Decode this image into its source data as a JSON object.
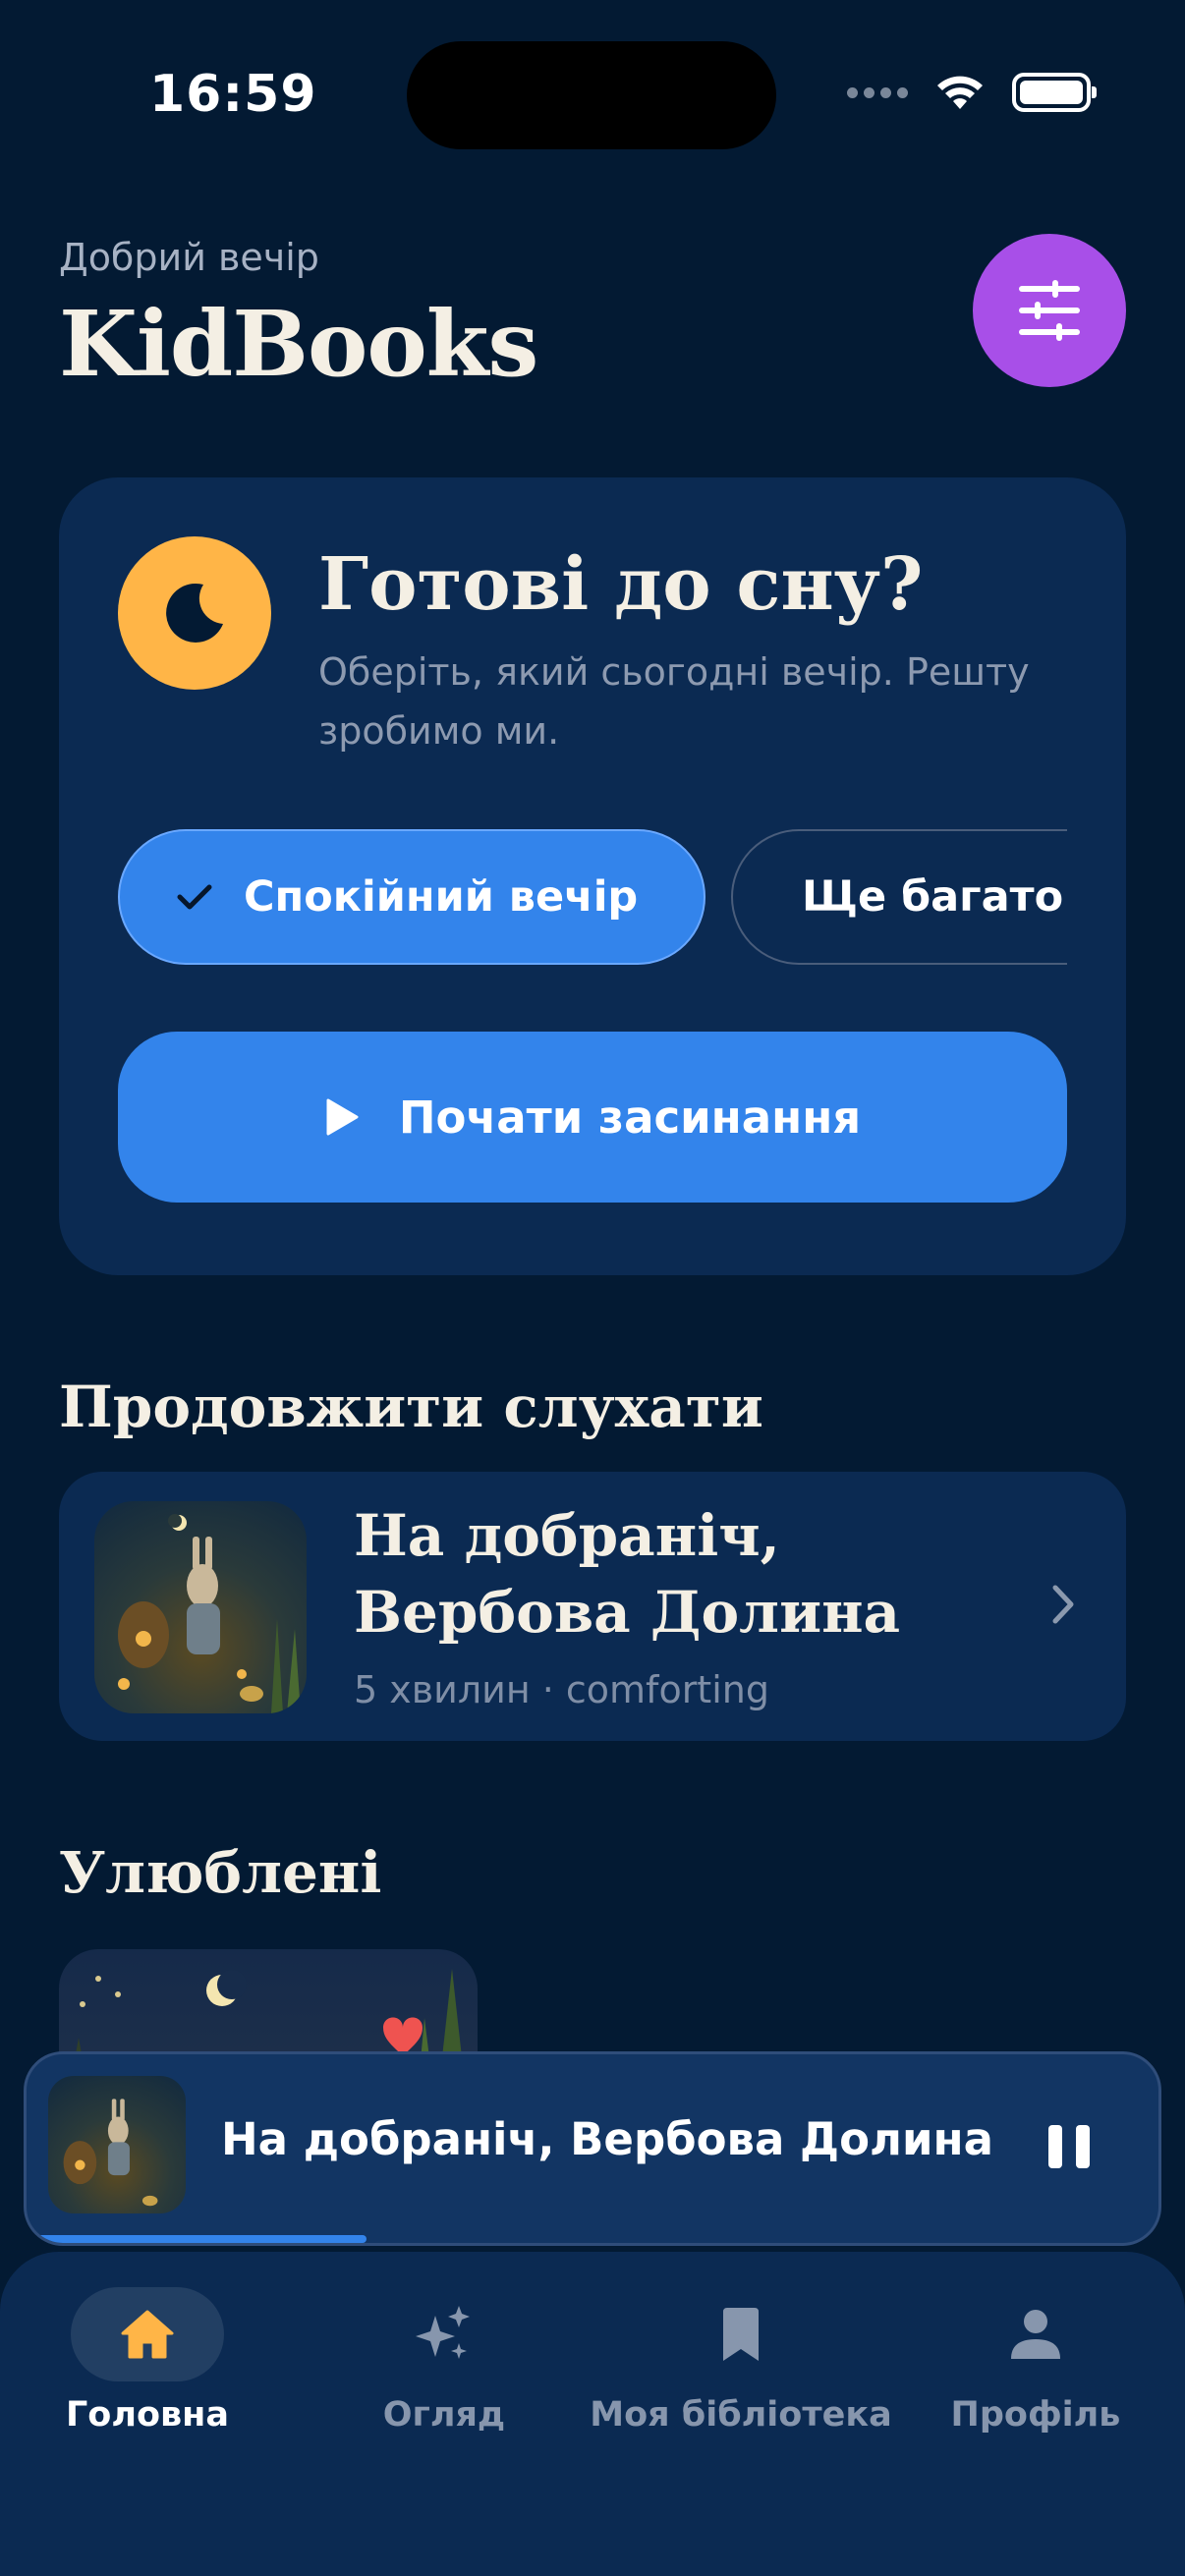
{
  "status_bar": {
    "time": "16:59"
  },
  "header": {
    "greeting": "Добрий вечір",
    "title": "KidBooks"
  },
  "bedtime_card": {
    "title": "Готові до сну?",
    "subtitle": "Оберіть, який сьогодні вечір. Решту зробимо ми.",
    "chips": [
      {
        "label": "Спокійний вечір",
        "selected": true
      },
      {
        "label": "Ще багато енергії",
        "selected": false
      }
    ],
    "start_button": "Почати засинання"
  },
  "continue_section": {
    "title": "Продовжити слухати",
    "item": {
      "title": "На добраніч, Вербова Долина",
      "meta": "5 хвилин · comforting"
    }
  },
  "favorites_section": {
    "title": "Улюблені"
  },
  "mini_player": {
    "title": "На добраніч, Вербова Долина",
    "progress": 0.3
  },
  "tabbar": {
    "items": [
      {
        "label": "Головна",
        "icon": "home-icon",
        "active": true
      },
      {
        "label": "Огляд",
        "icon": "sparkles-icon",
        "active": false
      },
      {
        "label": "Моя бібліотека",
        "icon": "bookmark-icon",
        "active": false
      },
      {
        "label": "Профіль",
        "icon": "person-icon",
        "active": false
      }
    ]
  },
  "colors": {
    "background": "#031a33",
    "card": "#0b2a52",
    "accent_blue": "#3384eb",
    "accent_purple": "#a84fe8",
    "accent_orange": "#ffb547"
  }
}
